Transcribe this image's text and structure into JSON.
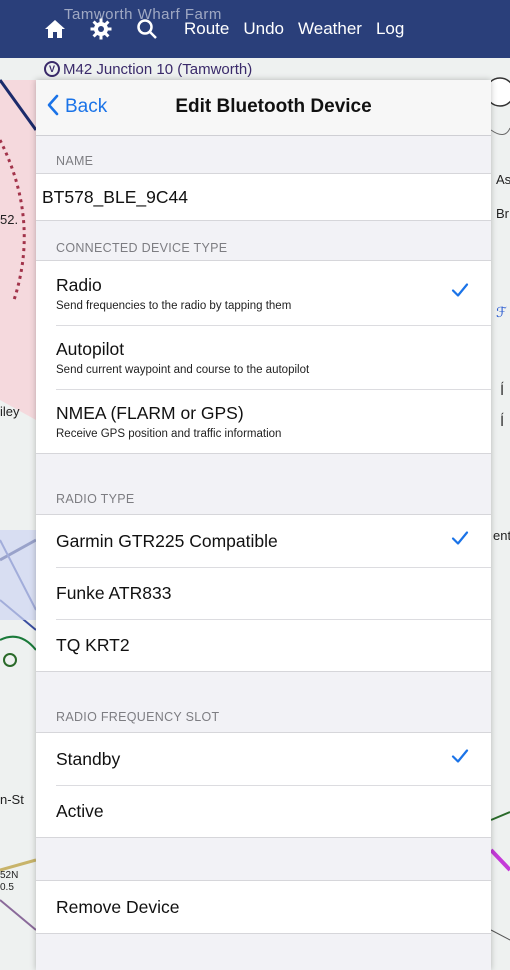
{
  "toolbar": {
    "route_label": "Route",
    "undo_label": "Undo",
    "weather_label": "Weather",
    "log_label": "Log",
    "ghost_text": "Tamworth   Wharf Farm"
  },
  "map": {
    "route_chip_text": "M42 Junction 10 (Tamworth)",
    "waypoint_symbol": "V",
    "labels": {
      "l52": "52.",
      "iley": "iley",
      "nst": "n-St",
      "as": "As",
      "bri": "Br",
      "ent": "ent",
      "s52": "52N",
      "s05": "0.5"
    }
  },
  "panel": {
    "back_label": "Back",
    "title": "Edit Bluetooth Device",
    "name_header": "NAME",
    "name_value": "BT578_BLE_9C44",
    "device_type_header": "CONNECTED DEVICE TYPE",
    "device_types": [
      {
        "title": "Radio",
        "subtitle": "Send frequencies to the radio by tapping them",
        "selected": true
      },
      {
        "title": "Autopilot",
        "subtitle": "Send current waypoint and course to the autopilot",
        "selected": false
      },
      {
        "title": "NMEA (FLARM or GPS)",
        "subtitle": "Receive GPS position and traffic information",
        "selected": false
      }
    ],
    "radio_type_header": "RADIO TYPE",
    "radio_types": [
      {
        "title": "Garmin GTR225 Compatible",
        "selected": true
      },
      {
        "title": "Funke ATR833",
        "selected": false
      },
      {
        "title": "TQ KRT2",
        "selected": false
      }
    ],
    "slot_header": "RADIO FREQUENCY SLOT",
    "slots": [
      {
        "title": "Standby",
        "selected": true
      },
      {
        "title": "Active",
        "selected": false
      }
    ],
    "remove_label": "Remove Device"
  },
  "colors": {
    "accent": "#1a73e8",
    "danger": "#d2352b",
    "toolbar": "#2a3f7a"
  }
}
